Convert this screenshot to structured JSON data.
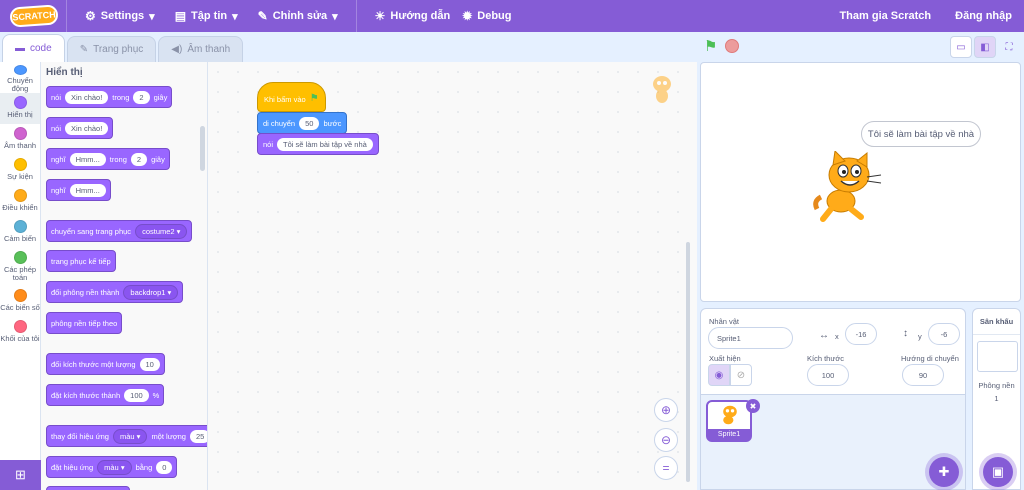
{
  "menubar": {
    "logo": "SCRATCH",
    "settings": "Settings",
    "file": "Tập tin",
    "edit": "Chỉnh sửa",
    "tutorials": "Hướng dẫn",
    "debug": "Debug",
    "join": "Tham gia Scratch",
    "signin": "Đăng nhập"
  },
  "tabs": {
    "code": "code",
    "costumes": "Trang phục",
    "sounds": "Âm thanh"
  },
  "categories": [
    {
      "label": "Chuyển động",
      "color": "#4c97ff"
    },
    {
      "label": "Hiển thị",
      "color": "#9966ff"
    },
    {
      "label": "Âm thanh",
      "color": "#cf63cf"
    },
    {
      "label": "Sự kiện",
      "color": "#ffbf00"
    },
    {
      "label": "Điều khiển",
      "color": "#ffab19"
    },
    {
      "label": "Cảm biến",
      "color": "#5cb1d6"
    },
    {
      "label": "Các phép toán",
      "color": "#59c059"
    },
    {
      "label": "Các biến số",
      "color": "#ff8c1a"
    },
    {
      "label": "Khối của tôi",
      "color": "#ff6680"
    }
  ],
  "palette": {
    "title": "Hiển thị",
    "blocks": {
      "b1": {
        "a": "nói",
        "v": "Xin chào!",
        "b": "trong",
        "n": "2",
        "c": "giây"
      },
      "b2": {
        "a": "nói",
        "v": "Xin chào!"
      },
      "b3": {
        "a": "nghĩ",
        "v": "Hmm...",
        "b": "trong",
        "n": "2",
        "c": "giây"
      },
      "b4": {
        "a": "nghĩ",
        "v": "Hmm..."
      },
      "b5": {
        "a": "chuyển sang trang phục",
        "d": "costume2"
      },
      "b6": {
        "a": "trang phục kế tiếp"
      },
      "b7": {
        "a": "đổi phông nền thành",
        "d": "backdrop1"
      },
      "b8": {
        "a": "phông nền tiếp theo"
      },
      "b9": {
        "a": "đổi kích thước một lượng",
        "v": "10"
      },
      "b10": {
        "a": "đặt kích thước thành",
        "v": "100",
        "b": "%"
      },
      "b11": {
        "a": "thay đổi hiệu ứng",
        "d": "màu",
        "b": "một lượng",
        "v": "25"
      },
      "b12": {
        "a": "đặt hiệu ứng",
        "d": "màu",
        "b": "bằng",
        "v": "0"
      }
    }
  },
  "script": {
    "hat": "Khi bấm vào",
    "move_a": "di chuyển",
    "move_n": "50",
    "move_b": "bước",
    "say_a": "nói",
    "say_v": "Tôi sẽ làm bài tập về nhà"
  },
  "stage": {
    "bubble": "Tôi sẽ làm bài tập về nhà"
  },
  "sprite_info": {
    "sprite_label": "Nhân vật",
    "sprite_name": "Sprite1",
    "x_label": "x",
    "x_value": "-16",
    "y_label": "y",
    "y_value": "-6",
    "show_label": "Xuất hiện",
    "size_label": "Kích thước",
    "size_value": "100",
    "direction_label": "Hướng di chuyển",
    "direction_value": "90"
  },
  "sprite_list": [
    {
      "name": "Sprite1"
    }
  ],
  "stage_panel": {
    "title": "Sân khấu",
    "backdrops_label": "Phông nền",
    "backdrops_count": "1"
  }
}
